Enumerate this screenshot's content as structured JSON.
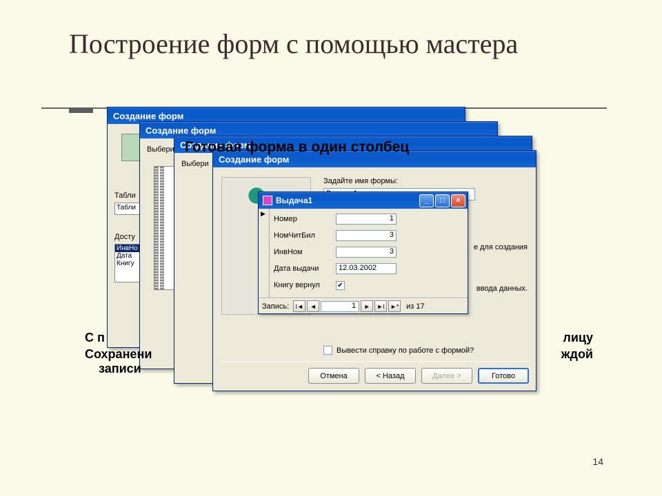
{
  "slide": {
    "title": "Построение форм с помощью мастера",
    "page_number": "14"
  },
  "overlay_captions": {
    "ready": "Готовая форма в один столбец",
    "left1": "С п",
    "left2_a": "Сохранени",
    "left2_b": "записи",
    "right1": "лицу",
    "right2": "ждой"
  },
  "wizard_title": "Создание форм",
  "win1": {
    "tabl_label": "Табли",
    "tabl_value": "Табли",
    "dostup": "Досту",
    "list": [
      "ИнвНо",
      "Дата",
      "Книгу"
    ]
  },
  "win23": {
    "vyber": "Выбери"
  },
  "win4": {
    "prompt": "Задайте имя формы:",
    "name_value": "Выдача1",
    "hint1_suffix": "е для создания",
    "hint2_suffix": "ввода данных.",
    "help_check": "Вывести справку по работе с формой?",
    "buttons": {
      "cancel": "Отмена",
      "back": "< Назад",
      "next": "Далее >",
      "finish": "Готово"
    }
  },
  "form_window": {
    "title": "Выдача1",
    "fields": {
      "f1_label": "Номер",
      "f1_value": "1",
      "f2_label": "НомЧитБил",
      "f2_value": "3",
      "f3_label": "ИнвНом",
      "f3_value": "3",
      "f4_label": "Дата выдачи",
      "f4_value": "12.03.2002",
      "f5_label": "Книгу вернул",
      "f5_checked": "✔"
    },
    "nav": {
      "label": "Запись:",
      "current": "1",
      "total": "из  17"
    }
  }
}
